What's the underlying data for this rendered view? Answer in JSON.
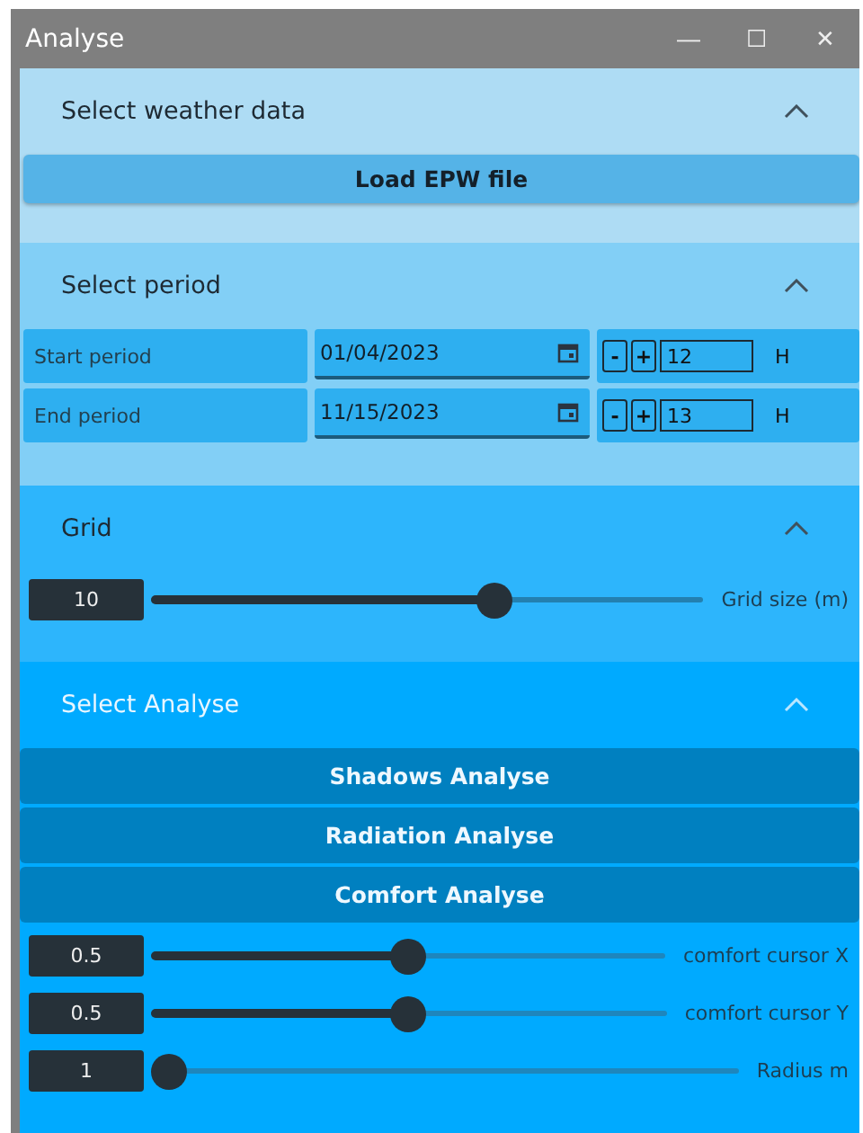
{
  "window": {
    "title": "Analyse",
    "controls": [
      "—",
      "☐",
      "✕"
    ]
  },
  "sections": [
    {
      "kind": "load",
      "title": "Select weather data",
      "expanded": true,
      "button": "Load EPW file"
    },
    {
      "kind": "period",
      "title": "Select period",
      "expanded": true,
      "rows": [
        {
          "label": "Start period",
          "date": "01/04/2023",
          "minus": "-",
          "plus": "+",
          "hour": "12",
          "unit": "H"
        },
        {
          "label": "End period",
          "date": "11/15/2023",
          "minus": "-",
          "plus": "+",
          "hour": "13",
          "unit": "H"
        }
      ]
    },
    {
      "kind": "sliders",
      "title": "Grid",
      "expanded": true,
      "sliders": [
        {
          "value": "10",
          "level": 0.63,
          "label": "Grid size (m)"
        }
      ]
    },
    {
      "kind": "analyse",
      "title": "Select Analyse",
      "expanded": true,
      "buttons": [
        "Shadows Analyse",
        "Radiation Analyse",
        "Comfort Analyse"
      ],
      "sliders": [
        {
          "value": "0.5",
          "level": 0.5,
          "label": "comfort cursor X"
        },
        {
          "value": "0.5",
          "level": 0.5,
          "label": "comfort cursor Y"
        },
        {
          "value": "1",
          "level": 0,
          "label": "Radius m"
        }
      ]
    }
  ]
}
